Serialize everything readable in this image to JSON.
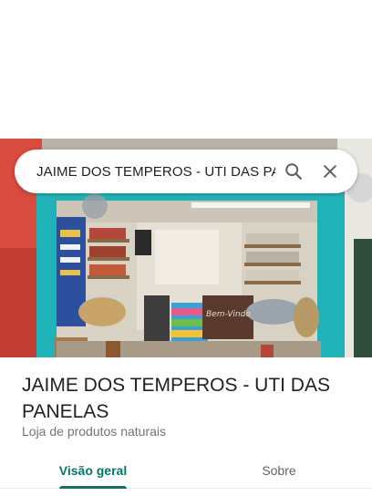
{
  "search": {
    "query": "JAIME DOS TEMPEROS - UTI DAS PANELAS",
    "search_icon": "search-icon",
    "close_icon": "close-icon"
  },
  "place": {
    "name": "JAIME DOS TEMPEROS - UTI DAS PANELAS",
    "category": "Loja de produtos naturais",
    "photo_sign_text": "Bem-Vindo"
  },
  "tabs": [
    {
      "label": "Visão geral",
      "active": true
    },
    {
      "label": "Sobre",
      "active": false
    }
  ],
  "colors": {
    "accent": "#00796b",
    "storefront_frame": "#1fb3b8",
    "wall_red": "#d94a3f"
  }
}
